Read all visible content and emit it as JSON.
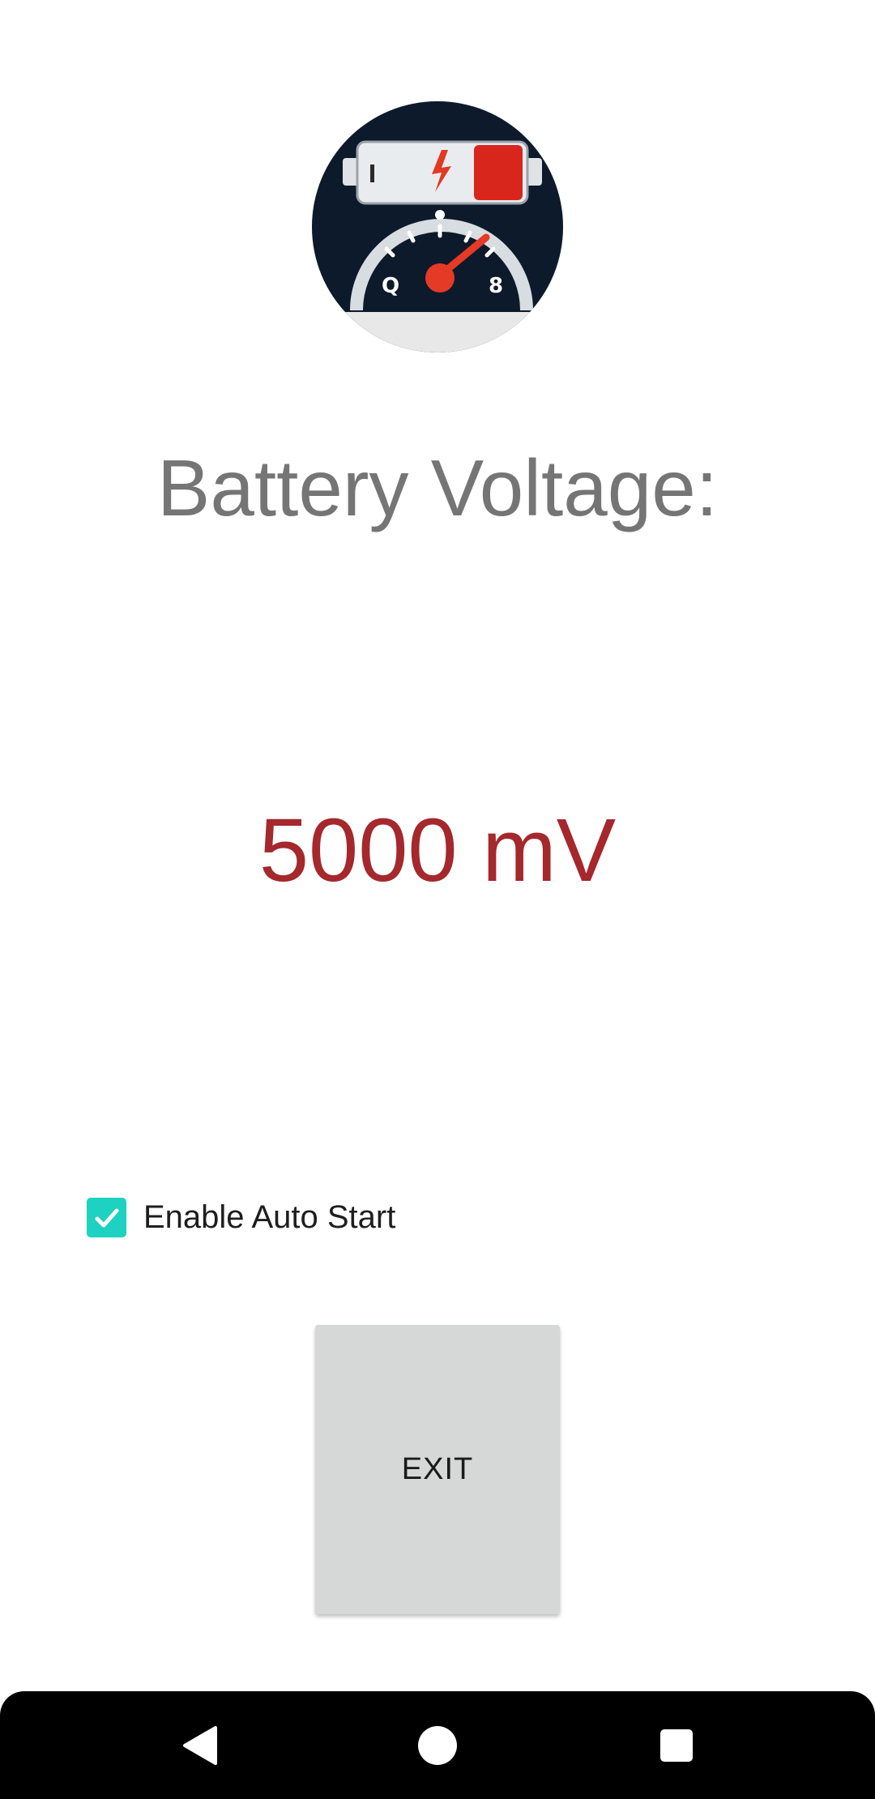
{
  "app": {
    "heading": "Battery Voltage:",
    "voltage_value": "5000 mV",
    "auto_start_label": "Enable Auto Start",
    "auto_start_checked": true,
    "exit_label": "EXIT"
  },
  "logo": {
    "icon": "battery-gauge-icon",
    "gauge_left_label": "Q",
    "gauge_right_label": "8"
  },
  "nav_bar": {
    "back_icon": "back-triangle-icon",
    "home_icon": "home-circle-icon",
    "recents_icon": "recents-square-icon"
  },
  "colors": {
    "heading": "#757575",
    "voltage": "#a4282c",
    "checkbox": "#1dd2c0",
    "button_bg": "#d6d7d7",
    "nav_bar_bg": "#000000"
  }
}
